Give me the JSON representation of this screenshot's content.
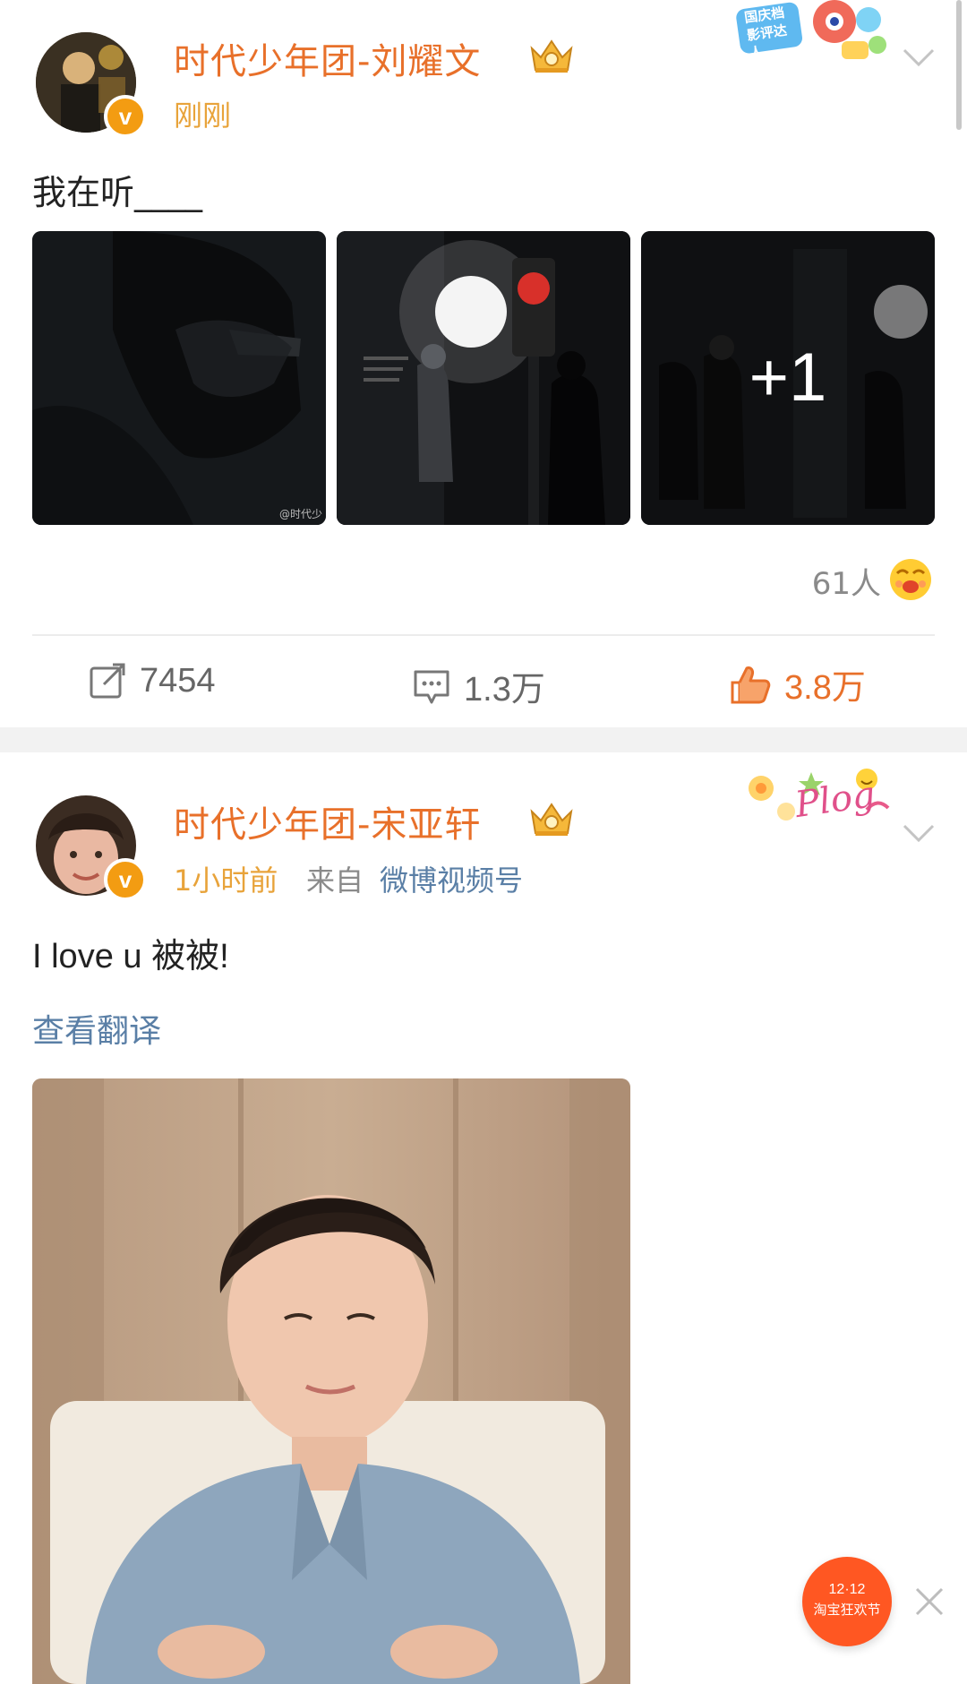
{
  "post1": {
    "username": "时代少年团-刘耀文",
    "time": "刚刚",
    "content": "我在听____",
    "badge_text": "国庆档影评达人",
    "more_images": "+1",
    "watermark": "@时代少",
    "reactions": {
      "count": "61人"
    },
    "actions": {
      "repost": "7454",
      "comment": "1.3万",
      "like": "3.8万"
    }
  },
  "post2": {
    "username": "时代少年团-宋亚轩",
    "time": "1小时前",
    "source_prefix": "来自",
    "source": "微博视频号",
    "content": "I love u 被被!",
    "translate": "查看翻译",
    "decoration": "Plog"
  },
  "float_ad": {
    "text1": "12·12",
    "text2": "淘宝狂欢节"
  },
  "colors": {
    "username": "#e8702a",
    "time": "#e8a33a",
    "link": "#5a7fa6",
    "like": "#e8702a",
    "gray": "#8a8a8a"
  }
}
